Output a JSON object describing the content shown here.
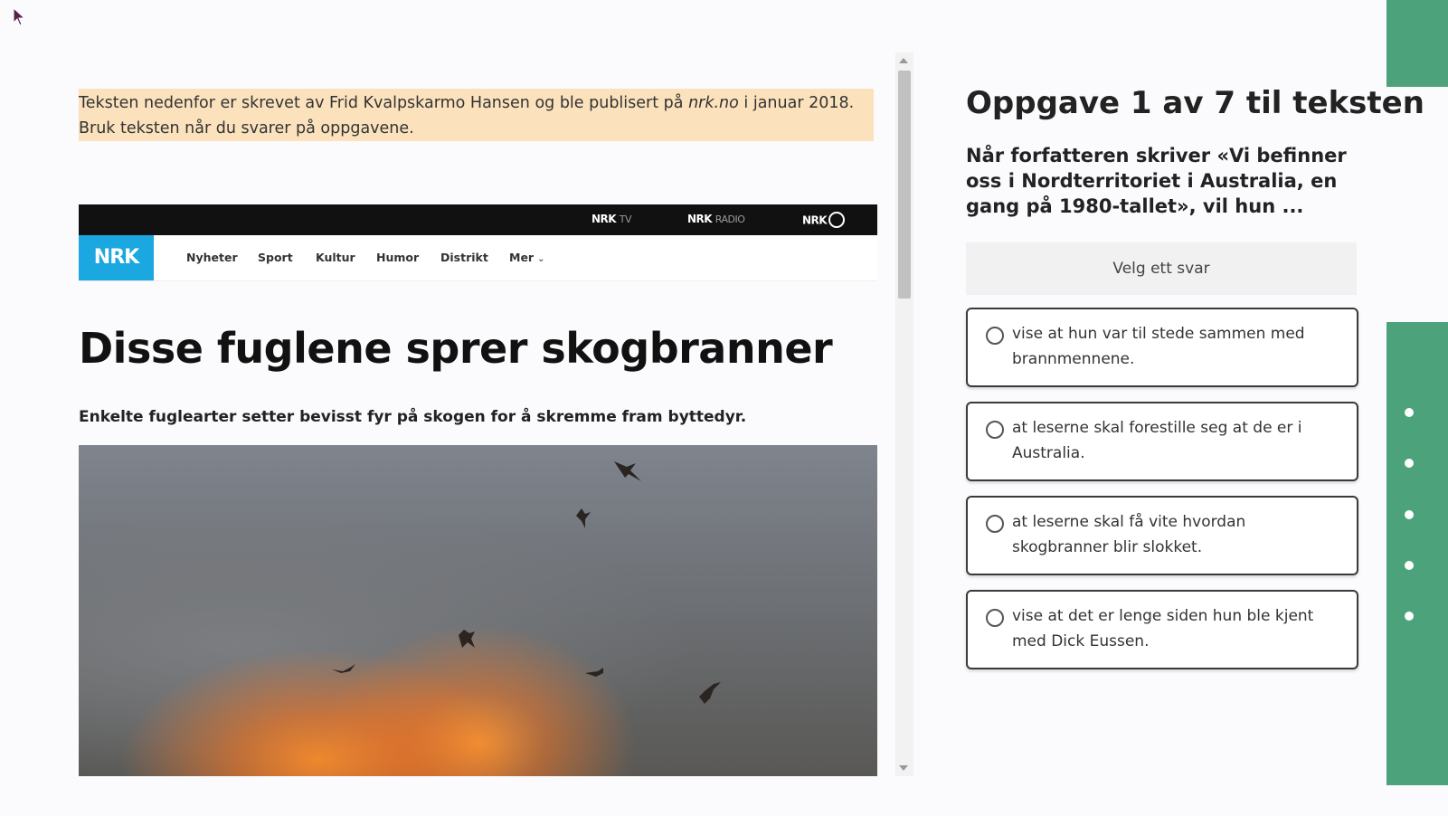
{
  "article": {
    "intro_pre": "Teksten nedenfor er skrevet av Frid Kvalpskarmo Hansen og ble publisert på ",
    "intro_site": "nrk.no",
    "intro_post": " i januar 2018. Bruk teksten når du svarer på oppgavene.",
    "top_links": [
      {
        "brand": "NRK",
        "suffix": "TV"
      },
      {
        "brand": "NRK",
        "suffix": "RADIO"
      },
      {
        "brand": "NRK",
        "suffix": ""
      }
    ],
    "logo": "NRK",
    "nav": [
      "Nyheter",
      "Sport",
      "Kultur",
      "Humor",
      "Distrikt",
      "Mer"
    ],
    "headline": "Disse fuglene sprer skogbranner",
    "lead": "Enkelte fuglearter setter bevisst fyr på skogen for å skremme fram byttedyr."
  },
  "task": {
    "title": "Oppgave 1 av 7 til teksten",
    "question": "Når forfatteren skriver «Vi befinner oss i Nordterritoriet i Australia, en gang på 1980-tallet», vil hun ...",
    "choose_label": "Velg ett svar",
    "options": [
      "vise at hun var til stede sammen med brannmennene.",
      "at leserne skal forestille seg at de er i Australia.",
      "at leserne skal få vite hvordan skogbranner blir slokket.",
      "vise at det er lenge siden hun ble kjent med Dick Eussen."
    ]
  },
  "colors": {
    "intro_bg": "#fbe2bd",
    "nrk_blue": "#1ba7df",
    "side_green": "#4ba27b"
  }
}
